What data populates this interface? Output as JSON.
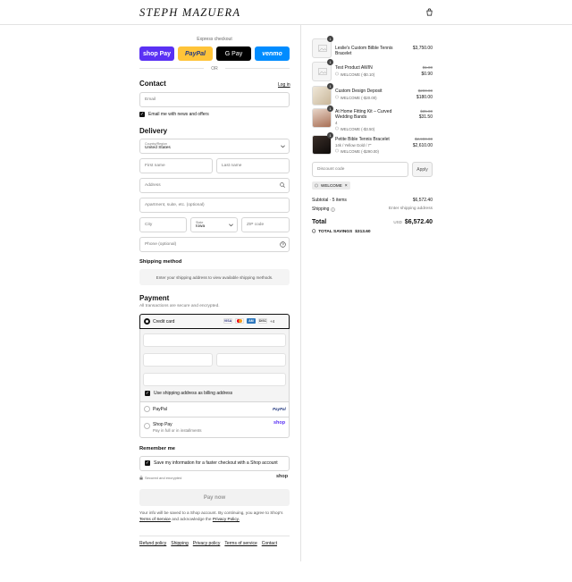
{
  "header": {
    "logo": "STEPH MAZUERA",
    "bag_icon": "bag-icon"
  },
  "express": {
    "title": "Express checkout",
    "buttons": [
      {
        "label": "shop Pay",
        "color": "#5a31f4"
      },
      {
        "label": "PayPal",
        "color": "#ffc439"
      },
      {
        "label": "G Pay",
        "color": "#000000"
      },
      {
        "label": "venmo",
        "color": "#008cff"
      }
    ],
    "or": "OR"
  },
  "contact": {
    "title": "Contact",
    "login": "Log in",
    "email_placeholder": "Email",
    "newsletter_label": "Email me with news and offers"
  },
  "delivery": {
    "title": "Delivery",
    "country_label": "Country/Region",
    "country_value": "United States",
    "first_name": "First name",
    "last_name": "Last name",
    "address": "Address",
    "apartment": "Apartment, suite, etc. (optional)",
    "city": "City",
    "state_label": "State",
    "state_value": "Iowa",
    "zip": "ZIP code",
    "phone": "Phone (optional)"
  },
  "shipping": {
    "title": "Shipping method",
    "message": "Enter your shipping address to view available shipping methods."
  },
  "payment": {
    "title": "Payment",
    "subtitle": "All transactions are secure and encrypted.",
    "credit_card": "Credit card",
    "more_cards": "+4",
    "billing_label": "Use shipping address as billing address",
    "paypal": "PayPal",
    "paypal_logo": "PayPal",
    "shoppay": "Shop Pay",
    "shoppay_sub": "Pay in full or in installments",
    "shoppay_logo": "shop"
  },
  "remember": {
    "title": "Remember me",
    "label": "Save my information for a faster checkout with a Shop account",
    "secure": "Secured and encrypted",
    "shop_logo": "shop"
  },
  "pay_now": "Pay now",
  "legal": {
    "text1": "Your info will be saved to a Shop account. By continuing, you agree to Shop's",
    "tos": "Terms of Service",
    "text2": "and acknowledge the",
    "privacy": "Privacy Policy."
  },
  "footer_links": [
    "Refund policy",
    "Shipping",
    "Privacy policy",
    "Terms of service",
    "Contact"
  ],
  "cart": {
    "items": [
      {
        "qty": "1",
        "name": "Leslie's Custom Bilble Tennis Bracelet",
        "variant": "",
        "discount": "",
        "old_price": "",
        "price": "$3,750.00"
      },
      {
        "qty": "1",
        "name": "Test Product AWIN",
        "variant": "",
        "discount": "WELCOME (-$0.10)",
        "old_price": "$1.00",
        "price": "$0.90"
      },
      {
        "qty": "1",
        "name": "Custom Design Deposit",
        "variant": "",
        "discount": "WELCOME (-$20.00)",
        "old_price": "$200.00",
        "price": "$180.00"
      },
      {
        "qty": "1",
        "name": "At Home Fitting Kit – Curved Wedding Bands",
        "variant": "4",
        "discount": "WELCOME (-$3.50)",
        "old_price": "$35.00",
        "price": "$31.50"
      },
      {
        "qty": "1",
        "name": "Petite Bible Tennis Bracelet",
        "variant": "14k / Yellow Gold / 7\"",
        "discount": "WELCOME (-$290.00)",
        "old_price": "$2,900.00",
        "price": "$2,610.00"
      }
    ],
    "discount_placeholder": "Discount code",
    "apply": "Apply",
    "tag": "WELCOME",
    "subtotal_label": "Subtotal · 5 items",
    "subtotal": "$6,572.40",
    "shipping_label": "Shipping",
    "shipping_value": "Enter shipping address",
    "total_label": "Total",
    "currency": "USD",
    "total": "$6,572.40",
    "savings_label": "TOTAL SAVINGS",
    "savings": "$313.60"
  }
}
